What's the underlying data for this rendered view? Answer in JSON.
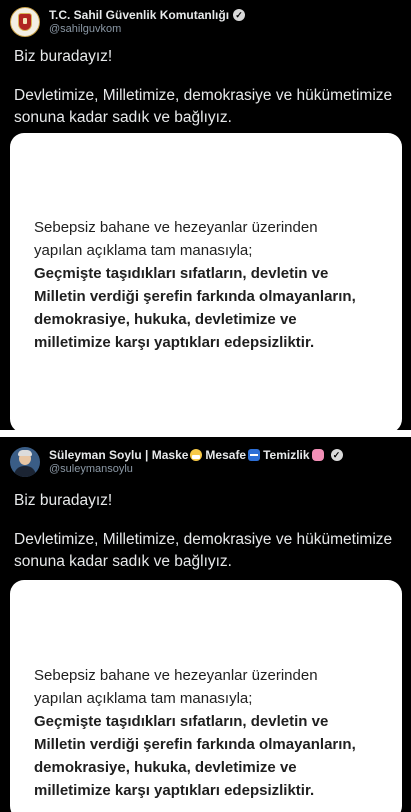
{
  "tweets": [
    {
      "display_name": "T.C. Sahil Güvenlik Komutanlığı",
      "handle": "@sahilguvkom",
      "greeting": "Biz buradayız!",
      "body": "Devletimize, Milletimize, demokrasiye ve hükümetimize sonuna kadar sadık ve bağlıyız.",
      "statement": {
        "line1": "Sebepsiz bahane ve hezeyanlar üzerinden",
        "line2": "yapılan açıklama tam manasıyla;",
        "line3": "Geçmişte taşıdıkları sıfatların, devletin ve",
        "line4": "Milletin verdiği şerefin farkında olmayanların,",
        "line5": "demokrasiye, hukuka, devletimize ve",
        "line6": "milletimize karşı yaptıkları edepsizliktir."
      }
    },
    {
      "display_name_parts": [
        "Süleyman Soylu | Maske",
        "Mesafe",
        "Temizlik"
      ],
      "handle": "@suleymansoylu",
      "greeting": "Biz buradayız!",
      "body": "Devletimize, Milletimize, demokrasiye ve hükümetimize sonuna kadar sadık ve bağlıyız.",
      "statement": {
        "line1": "Sebepsiz bahane ve hezeyanlar üzerinden",
        "line2": "yapılan açıklama tam manasıyla;",
        "line3": "Geçmişte taşıdıkları sıfatların, devletin ve",
        "line4": "Milletin verdiği şerefin farkında olmayanların,",
        "line5": "demokrasiye, hukuka, devletimize ve",
        "line6": "milletimize karşı yaptıkları edepsizliktir."
      }
    }
  ],
  "icons": {
    "verified": "✓",
    "emoji_1": "face-with-mask-icon",
    "emoji_2": "left-right-arrow-icon",
    "emoji_3": "soap-icon"
  }
}
